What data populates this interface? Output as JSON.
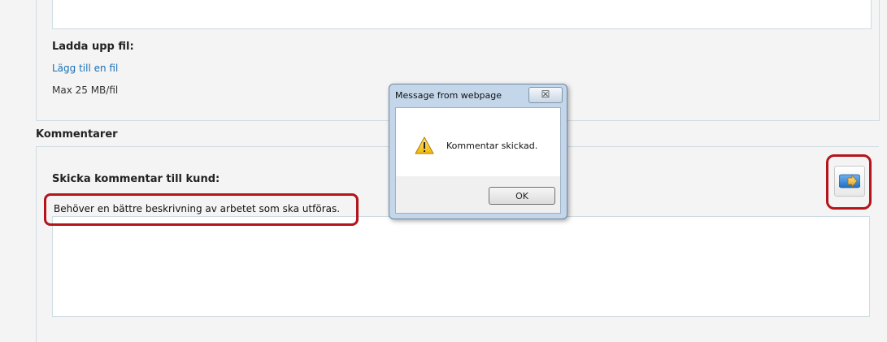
{
  "upload": {
    "title": "Ladda upp fil:",
    "add_file_link": "Lägg till en fil",
    "max_size": "Max 25 MB/fil"
  },
  "comments": {
    "heading": "Kommentarer",
    "send_title": "Skicka kommentar till kund:",
    "comment_value": "Behöver en bättre beskrivning av arbetet som ska utföras."
  },
  "dialog": {
    "title": "Message from webpage",
    "close_label": "☒",
    "message": "Kommentar skickad.",
    "ok_label": "OK"
  },
  "icons": {
    "send": "arrow-right-icon",
    "warning": "warning-icon",
    "close": "close-icon"
  },
  "colors": {
    "highlight": "#b3151b",
    "link": "#1a6fb6",
    "panel_border": "#cfdbe3"
  }
}
